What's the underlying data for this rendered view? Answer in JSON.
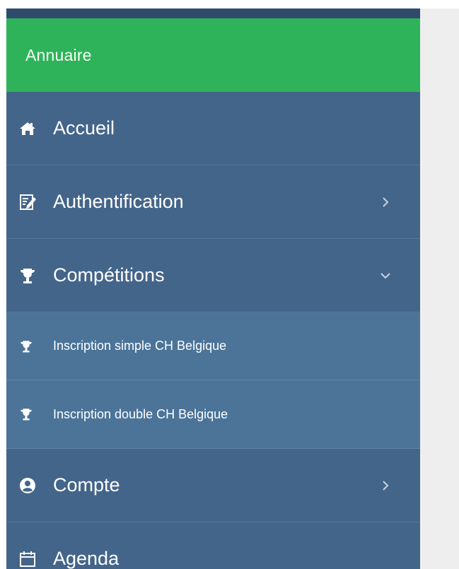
{
  "sidebar": {
    "brand": "Annuaire",
    "items": [
      {
        "label": "Accueil",
        "icon": "home-icon",
        "chevron": null
      },
      {
        "label": "Authentification",
        "icon": "edit-form-icon",
        "chevron": "chevron-right-icon"
      },
      {
        "label": "Compétitions",
        "icon": "trophy-icon",
        "chevron": "chevron-down-icon"
      },
      {
        "label": "Inscription simple CH Belgique",
        "icon": "trophy-icon",
        "chevron": null
      },
      {
        "label": "Inscription double CH Belgique",
        "icon": "trophy-icon",
        "chevron": null
      },
      {
        "label": "Compte",
        "icon": "user-circle-icon",
        "chevron": "chevron-right-icon"
      },
      {
        "label": "Agenda",
        "icon": "calendar-icon",
        "chevron": null
      }
    ]
  },
  "colors": {
    "sidebar_bg": "#44658a",
    "sidebar_top": "#2f4b6c",
    "brand_bg": "#2fb35a",
    "submenu_bg": "#4b7498",
    "content_bg": "#eeeeee"
  }
}
